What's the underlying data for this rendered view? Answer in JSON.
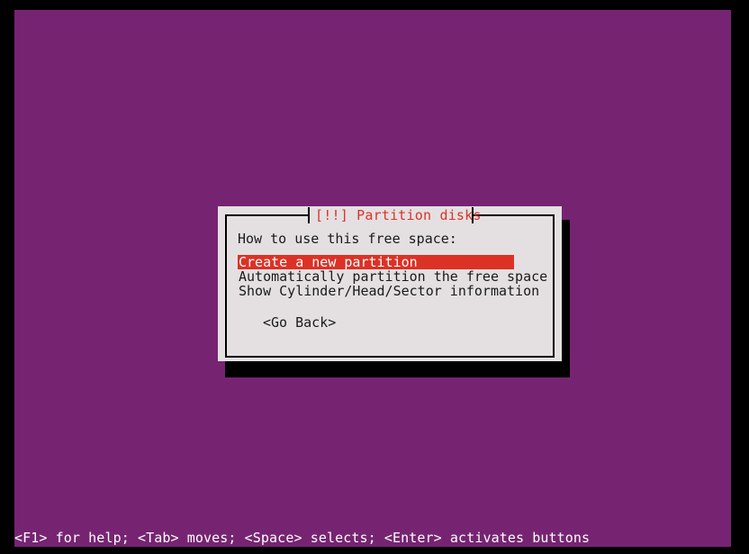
{
  "colors": {
    "console_background": "#762472",
    "letterbox": "#000000",
    "dialog_background": "#e4e0e2",
    "dialog_border": "#000000",
    "accent_red": "#dc3226",
    "selected_text": "#ffffff",
    "body_text": "#1a1a1a",
    "status_text": "#ffffff"
  },
  "dialog": {
    "title": "[!!] Partition disks",
    "prompt": "How to use this free space:",
    "menu": [
      {
        "label": "Create a new partition",
        "selected": true
      },
      {
        "label": "Automatically partition the free space",
        "selected": false
      },
      {
        "label": "Show Cylinder/Head/Sector information",
        "selected": false
      }
    ],
    "go_back_label": "<Go Back>"
  },
  "status_bar": {
    "text": "<F1> for help; <Tab> moves; <Space> selects; <Enter> activates buttons"
  }
}
